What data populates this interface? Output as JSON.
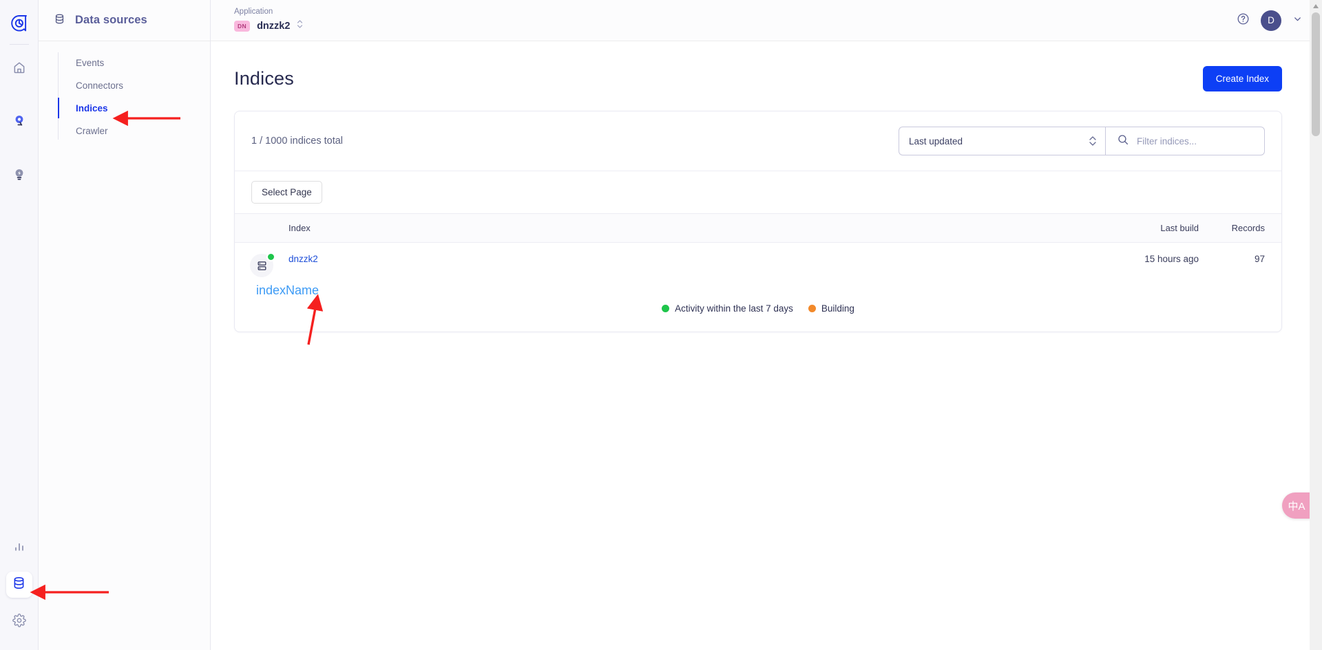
{
  "rail": {
    "logo_name": "algolia-logo",
    "items": [
      {
        "name": "home-icon",
        "label": "Home",
        "active": false
      },
      {
        "name": "search-icon",
        "label": "Search",
        "active": false
      },
      {
        "name": "recommend-icon",
        "label": "Recommend",
        "active": false
      }
    ],
    "bottom_items": [
      {
        "name": "analytics-icon",
        "label": "Analytics",
        "active": false
      },
      {
        "name": "data-sources-icon",
        "label": "Data sources",
        "active": true
      },
      {
        "name": "settings-gear-icon",
        "label": "Settings",
        "active": false
      }
    ]
  },
  "sidebar": {
    "title": "Data sources",
    "title_icon": "database-icon",
    "items": [
      {
        "label": "Events",
        "active": false
      },
      {
        "label": "Connectors",
        "active": false
      },
      {
        "label": "Indices",
        "active": true
      },
      {
        "label": "Crawler",
        "active": false
      }
    ]
  },
  "topbar": {
    "application_label": "Application",
    "application_badge": "DN",
    "application_name": "dnzzk2",
    "help_icon": "help-circle-icon",
    "avatar_initial": "D",
    "avatar_chevron": "chevron-down-icon"
  },
  "page": {
    "title": "Indices",
    "create_button": "Create Index"
  },
  "toolbar": {
    "count_text": "1 / 1000 indices total",
    "sort_value": "Last updated",
    "sort_spinner_icon": "spinner-updown-icon",
    "search_icon": "search-icon",
    "search_placeholder": "Filter indices...",
    "search_value": "",
    "select_page_button": "Select Page"
  },
  "table": {
    "columns": [
      "Index",
      "Last build",
      "Records"
    ],
    "rows": [
      {
        "icon": "index-stack-icon",
        "status_color": "#1ec54b",
        "index_name": "dnzzk2",
        "last_build": "15 hours ago",
        "records": "97"
      }
    ]
  },
  "legend": [
    {
      "color": "#1ec54b",
      "label": "Activity within the last 7 days"
    },
    {
      "color": "#f2892a",
      "label": "Building"
    }
  ],
  "annotations": {
    "index_name_label": "indexName",
    "arrow_color": "#f5201f"
  },
  "widgets": {
    "translate_label": "中A"
  },
  "colors": {
    "accent": "#0d3ff5",
    "link": "#1d4ed8",
    "active_nav": "#1b36e8",
    "badge_bg": "#f9b8dd",
    "annotation_text": "#3d9bf5"
  }
}
